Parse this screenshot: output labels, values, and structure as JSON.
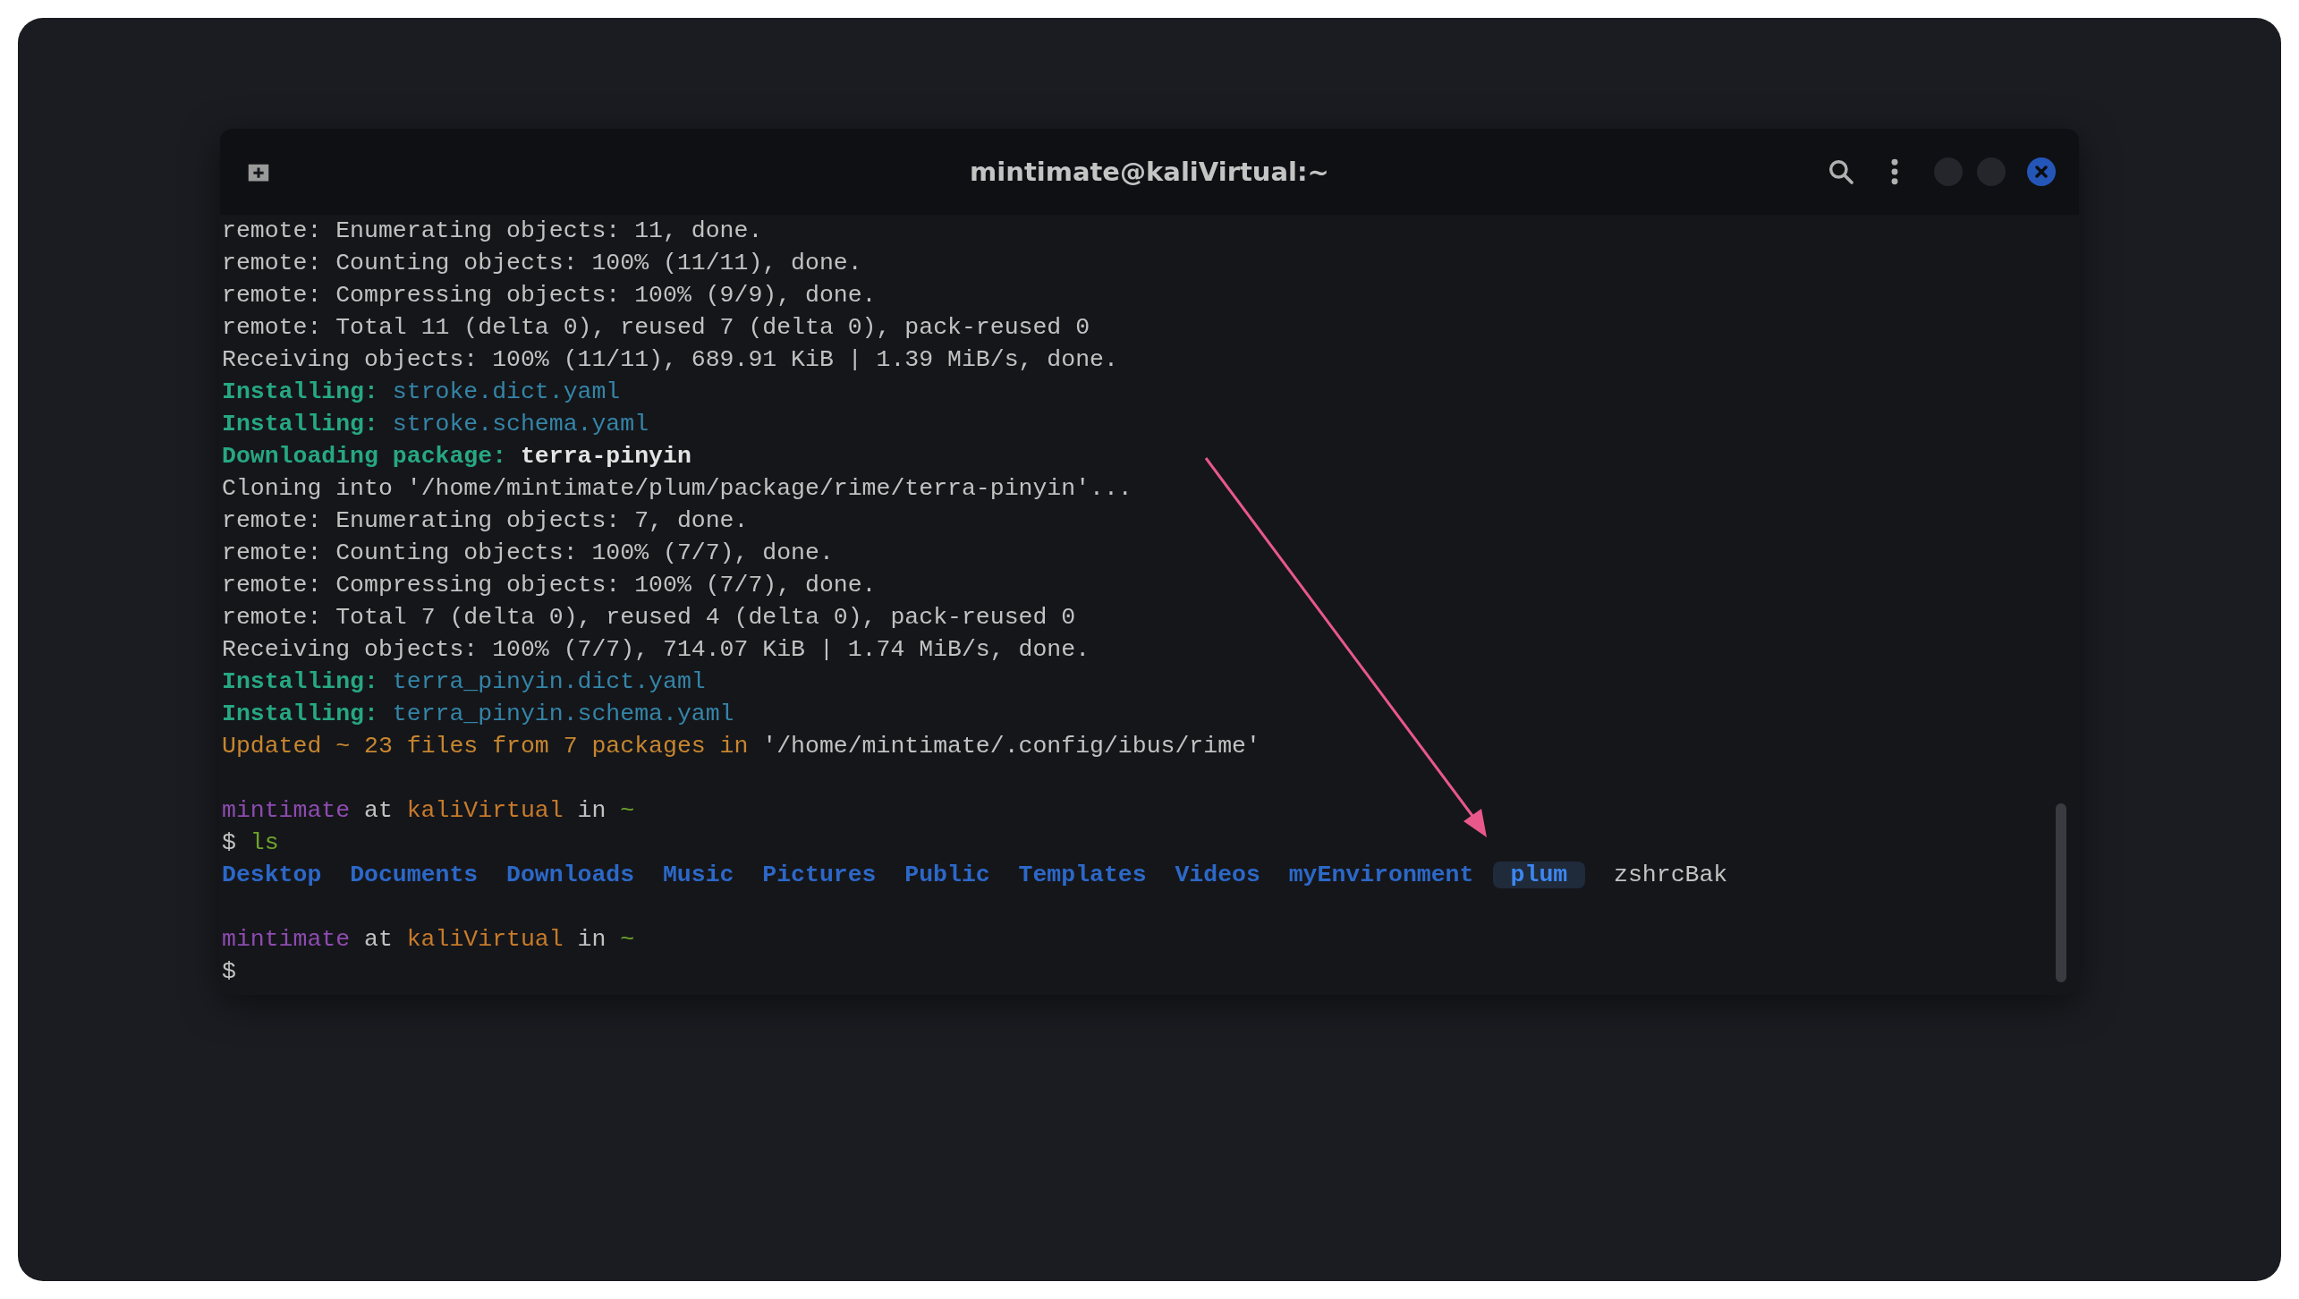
{
  "terminal": {
    "title": "mintimate@kaliVirtual:~",
    "lines": [
      {
        "kind": "text",
        "segments": [
          {
            "kind": "plain",
            "text": "remote: Enumerating objects: 11, done."
          }
        ]
      },
      {
        "kind": "text",
        "segments": [
          {
            "kind": "plain",
            "text": "remote: Counting objects: 100% (11/11), done."
          }
        ]
      },
      {
        "kind": "text",
        "segments": [
          {
            "kind": "plain",
            "text": "remote: Compressing objects: 100% (9/9), done."
          }
        ]
      },
      {
        "kind": "text",
        "segments": [
          {
            "kind": "plain",
            "text": "remote: Total 11 (delta 0), reused 7 (delta 0), pack-reused 0"
          }
        ]
      },
      {
        "kind": "text",
        "segments": [
          {
            "kind": "plain",
            "text": "Receiving objects: 100% (11/11), 689.91 KiB | 1.39 MiB/s, done."
          }
        ]
      },
      {
        "kind": "text",
        "segments": [
          {
            "kind": "label",
            "text": "Installing:"
          },
          {
            "kind": "file",
            "text": "stroke.dict.yaml"
          }
        ]
      },
      {
        "kind": "text",
        "segments": [
          {
            "kind": "label",
            "text": "Installing:"
          },
          {
            "kind": "file",
            "text": "stroke.schema.yaml"
          }
        ]
      },
      {
        "kind": "text",
        "segments": [
          {
            "kind": "label",
            "text": "Downloading package:"
          },
          {
            "kind": "bold",
            "text": "terra-pinyin"
          }
        ]
      },
      {
        "kind": "text",
        "segments": [
          {
            "kind": "plain",
            "text": "Cloning into '/home/mintimate/plum/package/rime/terra-pinyin'..."
          }
        ]
      },
      {
        "kind": "text",
        "segments": [
          {
            "kind": "plain",
            "text": "remote: Enumerating objects: 7, done."
          }
        ]
      },
      {
        "kind": "text",
        "segments": [
          {
            "kind": "plain",
            "text": "remote: Counting objects: 100% (7/7), done."
          }
        ]
      },
      {
        "kind": "text",
        "segments": [
          {
            "kind": "plain",
            "text": "remote: Compressing objects: 100% (7/7), done."
          }
        ]
      },
      {
        "kind": "text",
        "segments": [
          {
            "kind": "plain",
            "text": "remote: Total 7 (delta 0), reused 4 (delta 0), pack-reused 0"
          }
        ]
      },
      {
        "kind": "text",
        "segments": [
          {
            "kind": "plain",
            "text": "Receiving objects: 100% (7/7), 714.07 KiB | 1.74 MiB/s, done."
          }
        ]
      },
      {
        "kind": "text",
        "segments": [
          {
            "kind": "label",
            "text": "Installing:"
          },
          {
            "kind": "file",
            "text": "terra_pinyin.dict.yaml"
          }
        ]
      },
      {
        "kind": "text",
        "segments": [
          {
            "kind": "label",
            "text": "Installing:"
          },
          {
            "kind": "file",
            "text": "terra_pinyin.schema.yaml"
          }
        ]
      },
      {
        "kind": "text",
        "segments": [
          {
            "kind": "warn",
            "text": "Updated ~ 23 files from 7 packages in"
          },
          {
            "kind": "plain",
            "text": "'/home/mintimate/.config/ibus/rime'"
          }
        ]
      },
      {
        "kind": "blank"
      },
      {
        "kind": "text",
        "segments": [
          {
            "kind": "user",
            "text": "mintimate"
          },
          {
            "kind": "plain",
            "text": "at"
          },
          {
            "kind": "host",
            "text": "kaliVirtual"
          },
          {
            "kind": "plain",
            "text": "in"
          },
          {
            "kind": "path",
            "text": "~"
          }
        ]
      },
      {
        "kind": "text",
        "segments": [
          {
            "kind": "plain",
            "text": "$"
          },
          {
            "kind": "command",
            "text": "ls"
          }
        ]
      },
      {
        "kind": "ls",
        "items": [
          {
            "kind": "dir",
            "text": "Desktop"
          },
          {
            "kind": "dir",
            "text": "Documents"
          },
          {
            "kind": "dir",
            "text": "Downloads"
          },
          {
            "kind": "dir",
            "text": "Music"
          },
          {
            "kind": "dir",
            "text": "Pictures"
          },
          {
            "kind": "dir",
            "text": "Public"
          },
          {
            "kind": "dir",
            "text": "Templates"
          },
          {
            "kind": "dir",
            "text": "Videos"
          },
          {
            "kind": "dir",
            "text": "myEnvironment"
          },
          {
            "kind": "sticky",
            "text": "plum"
          },
          {
            "kind": "plainfile",
            "text": "zshrcBak"
          }
        ]
      },
      {
        "kind": "blank"
      },
      {
        "kind": "text",
        "segments": [
          {
            "kind": "user",
            "text": "mintimate"
          },
          {
            "kind": "plain",
            "text": "at"
          },
          {
            "kind": "host",
            "text": "kaliVirtual"
          },
          {
            "kind": "plain",
            "text": "in"
          },
          {
            "kind": "path",
            "text": "~"
          }
        ]
      },
      {
        "kind": "text",
        "segments": [
          {
            "kind": "plain",
            "text": "$"
          }
        ]
      }
    ]
  }
}
